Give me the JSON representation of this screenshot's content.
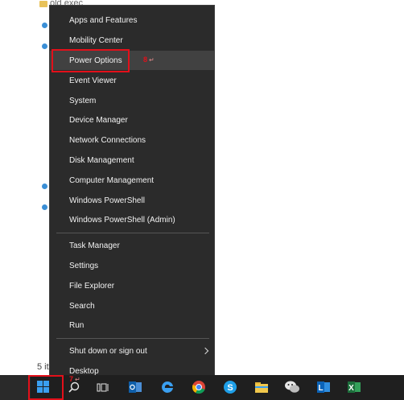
{
  "background": {
    "top_fragment": "old exec",
    "left_fragment": "5 it"
  },
  "menu": {
    "items_group1": [
      {
        "label": "Apps and Features"
      },
      {
        "label": "Mobility Center"
      },
      {
        "label": "Power Options"
      },
      {
        "label": "Event Viewer"
      },
      {
        "label": "System"
      },
      {
        "label": "Device Manager"
      },
      {
        "label": "Network Connections"
      },
      {
        "label": "Disk Management"
      },
      {
        "label": "Computer Management"
      },
      {
        "label": "Windows PowerShell"
      },
      {
        "label": "Windows PowerShell (Admin)"
      }
    ],
    "items_group2": [
      {
        "label": "Task Manager"
      },
      {
        "label": "Settings"
      },
      {
        "label": "File Explorer"
      },
      {
        "label": "Search"
      },
      {
        "label": "Run"
      }
    ],
    "items_group3": [
      {
        "label": "Shut down or sign out"
      },
      {
        "label": "Desktop"
      }
    ]
  },
  "annotations": {
    "power_options_marker": "8",
    "start_marker": "7"
  },
  "colors": {
    "menu_bg": "#2b2b2b",
    "hover_bg": "#414141",
    "annotation_red": "#e3101a",
    "taskbar_bg": "#1f1f1f",
    "windows_blue": "#3a9ff0"
  },
  "taskbar": {
    "icons": [
      "windows-start-icon",
      "search-icon",
      "task-view-icon",
      "outlook-icon",
      "edge-icon",
      "chrome-icon",
      "skype-icon",
      "file-explorer-icon",
      "wechat-icon",
      "lync-icon",
      "excel-icon"
    ]
  }
}
